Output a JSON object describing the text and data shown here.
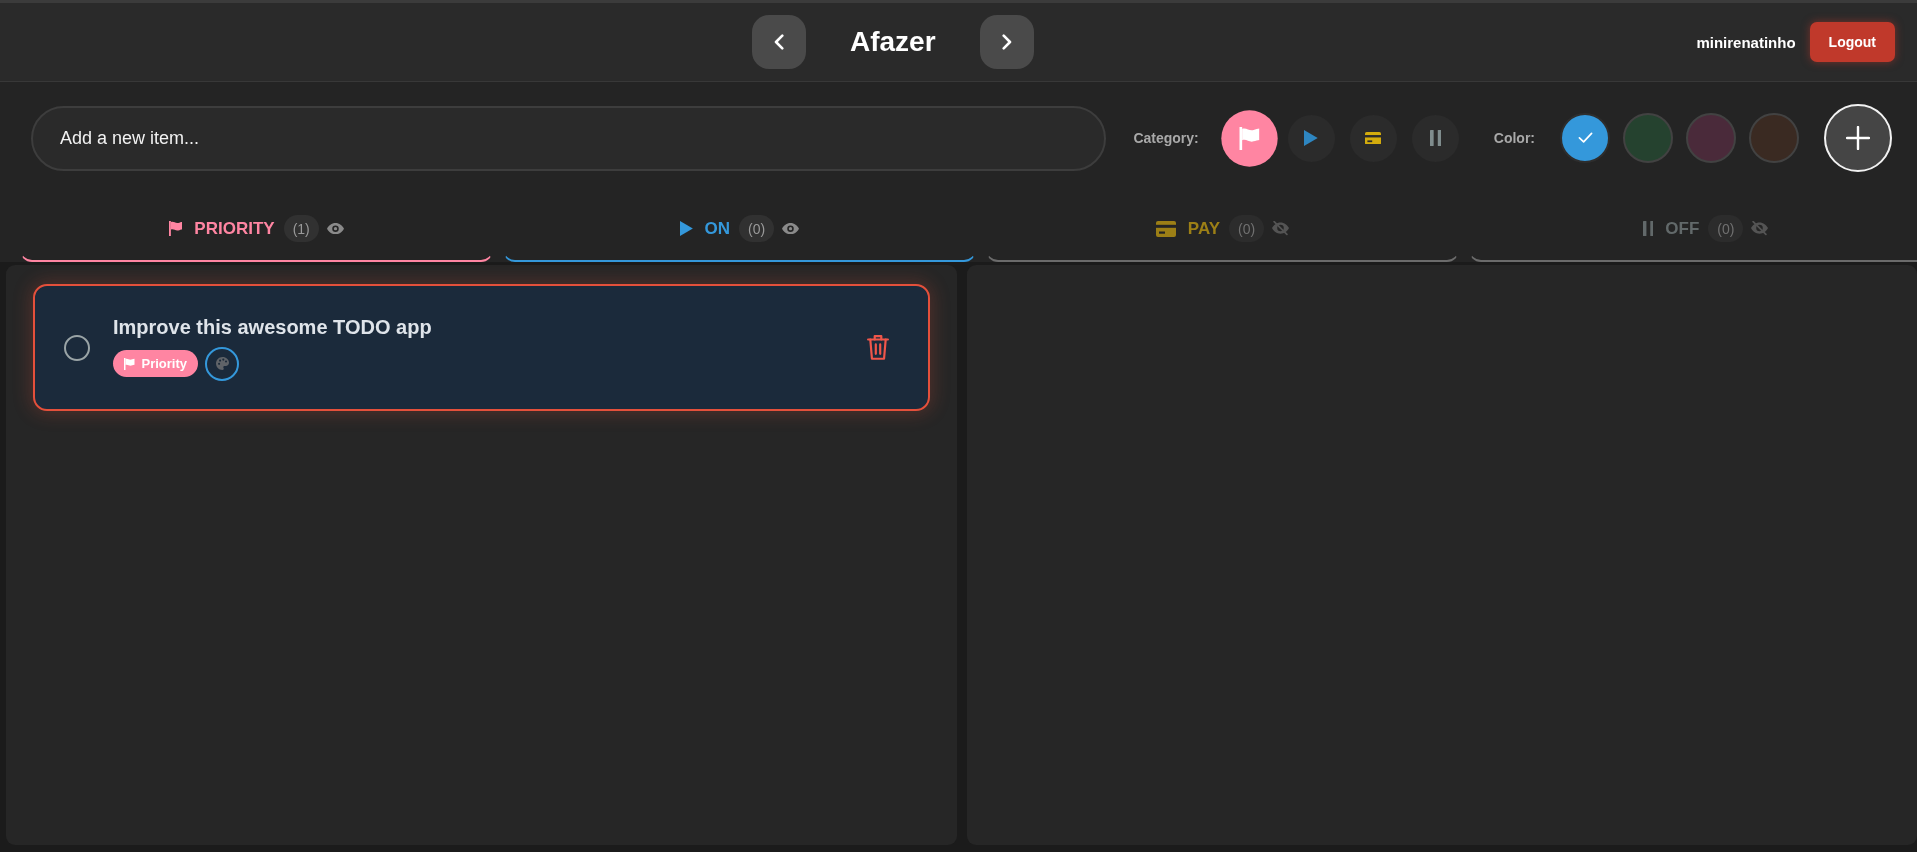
{
  "header": {
    "title": "Afazer",
    "username": "minirenatinho",
    "logout_button": "Logout"
  },
  "composer": {
    "placeholder": "Add a new item...",
    "category_label": "Category:",
    "categories": [
      {
        "kind": "flag",
        "color": "#ff85a2",
        "selected": true
      },
      {
        "kind": "play",
        "color": "#2e86c1",
        "selected": false
      },
      {
        "kind": "card",
        "color": "#d4ac0d",
        "selected": false
      },
      {
        "kind": "pause",
        "color": "#7f8c8d",
        "selected": false
      }
    ],
    "color_label": "Color:",
    "colors": [
      {
        "color": "#3498db",
        "selected": true
      },
      {
        "color": "#25422f",
        "selected": false
      },
      {
        "color": "#4a2a3a",
        "selected": false
      },
      {
        "color": "#3a2a22",
        "selected": false
      }
    ]
  },
  "tabs": [
    {
      "kind": "flag",
      "label": "PRIORITY",
      "count": "(1)",
      "color": "#ff85a2",
      "visible": true,
      "items": [
        {
          "title": "Improve this awesome TODO app",
          "done": false,
          "tag": {
            "kind": "flag",
            "label": "Priority",
            "color": "#ff85a2"
          },
          "color": "#3498db"
        }
      ]
    },
    {
      "kind": "play",
      "label": "ON",
      "count": "(0)",
      "color": "#3498db",
      "visible": true
    },
    {
      "kind": "card",
      "label": "PAY",
      "count": "(0)",
      "color": "#9c7f16",
      "visible": false
    },
    {
      "kind": "pause",
      "label": "OFF",
      "count": "(0)",
      "color": "#62696a",
      "visible": false
    }
  ]
}
